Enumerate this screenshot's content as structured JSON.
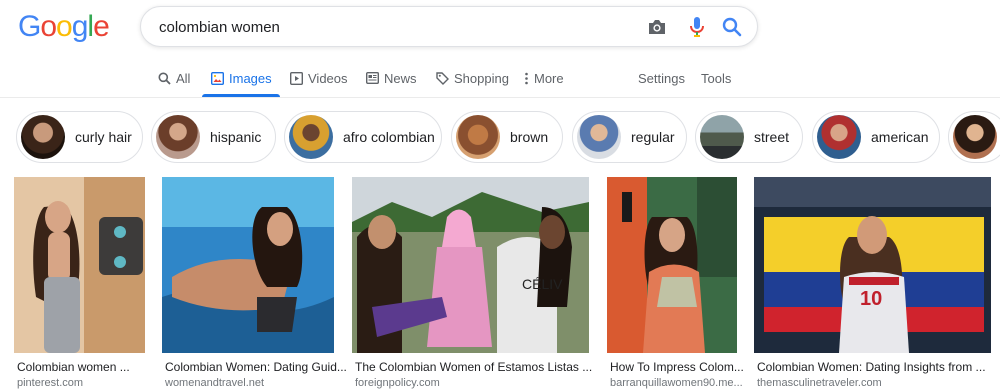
{
  "logo": {
    "letters": [
      "G",
      "o",
      "o",
      "g",
      "l",
      "e"
    ],
    "colors": [
      "#4285F4",
      "#EA4335",
      "#FBBC05",
      "#4285F4",
      "#34A853",
      "#EA4335"
    ]
  },
  "search": {
    "query": "colombian women",
    "camera_icon": "camera-icon",
    "mic_icon": "microphone-icon",
    "search_icon": "search-icon"
  },
  "tabs": {
    "all": "All",
    "images": "Images",
    "videos": "Videos",
    "news": "News",
    "shopping": "Shopping",
    "more": "More",
    "settings": "Settings",
    "tools": "Tools"
  },
  "chips": [
    {
      "label": "curly hair"
    },
    {
      "label": "hispanic"
    },
    {
      "label": "afro colombian"
    },
    {
      "label": "brown"
    },
    {
      "label": "regular"
    },
    {
      "label": "street"
    },
    {
      "label": "american"
    }
  ],
  "results": [
    {
      "title": "Colombian women ...",
      "source": "pinterest.com"
    },
    {
      "title": "Colombian Women: Dating Guid...",
      "source": "womenandtravel.net"
    },
    {
      "title": "The Colombian Women of Estamos Listas ...",
      "source": "foreignpolicy.com"
    },
    {
      "title": "How To Impress Colom...",
      "source": "barranquillawomen90.me..."
    },
    {
      "title": "Colombian Women: Dating Insights from ...",
      "source": "themasculinetraveler.com"
    }
  ],
  "colors": {
    "accent": "#1a73e8",
    "tab_text": "#5f6368",
    "source_text": "#70757a"
  }
}
